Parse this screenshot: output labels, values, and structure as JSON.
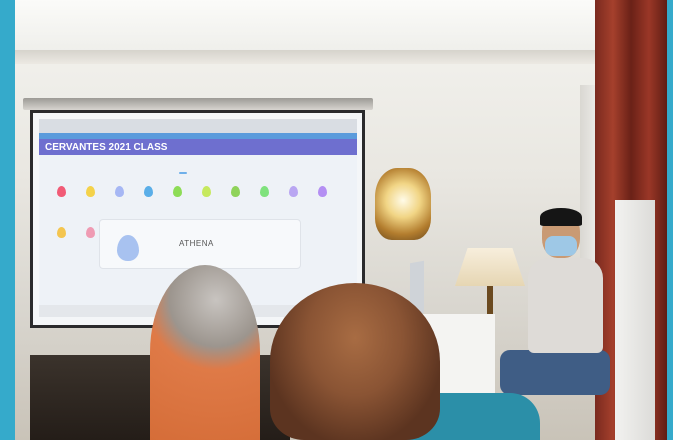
{
  "projection": {
    "class_title": "CERVANTES 2021 CLASS",
    "card_title": "ATHENA"
  },
  "colors": {
    "border": "#35aacb",
    "class_bar": "#6e6fcf",
    "banner": "#5b9bdc"
  },
  "eggs_row1": [
    "#f15b76",
    "#f4d24a",
    "#a6b7f4",
    "#5aaee8",
    "#8ddc56",
    "#c6e95e",
    "#8fd35a",
    "#7fe27d",
    "#b9a6f2",
    "#b48ff3"
  ],
  "eggs_row2": [
    "#f4c54f",
    "#ef9bb3"
  ],
  "card_egg": "#a8c2f0"
}
